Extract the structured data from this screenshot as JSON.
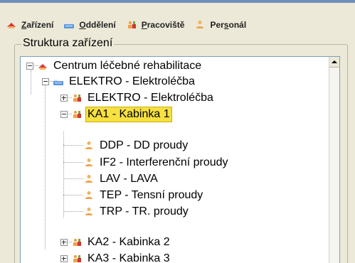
{
  "toolbar": {
    "items": [
      {
        "prefix": "",
        "underlined": "Z",
        "suffix": "ařízení",
        "icon": "device-icon"
      },
      {
        "prefix": "",
        "underlined": "O",
        "suffix": "ddělení",
        "icon": "department-icon"
      },
      {
        "prefix": "",
        "underlined": "P",
        "suffix": "racoviště",
        "icon": "workplace-icon"
      },
      {
        "prefix": "Per",
        "underlined": "s",
        "suffix": "onál",
        "icon": "person-icon"
      }
    ]
  },
  "structure": {
    "title": "Struktura zařízení"
  },
  "tree": {
    "nodes": [
      {
        "label": "Centrum léčebné rehabilitace",
        "icon": "center-icon"
      },
      {
        "label": "ELEKTRO - Elektroléčba",
        "icon": "department-icon"
      },
      {
        "label": "ELEKTRO - Elektroléčba",
        "icon": "workplace-icon"
      },
      {
        "label": "KA1 - Kabinka 1",
        "icon": "workplace-icon",
        "selected": true
      },
      {
        "label": "DDP - DD proudy",
        "icon": "person-icon"
      },
      {
        "label": "IF2 - Interferenční proudy",
        "icon": "person-icon"
      },
      {
        "label": "LAV - LAVA",
        "icon": "person-icon"
      },
      {
        "label": "TEP - Tensní proudy",
        "icon": "person-icon"
      },
      {
        "label": "TRP - TR. proudy",
        "icon": "person-icon"
      },
      {
        "label": "KA2 - Kabinka 2",
        "icon": "workplace-icon"
      },
      {
        "label": "KA3 - Kabinka 3",
        "icon": "workplace-icon"
      }
    ]
  }
}
